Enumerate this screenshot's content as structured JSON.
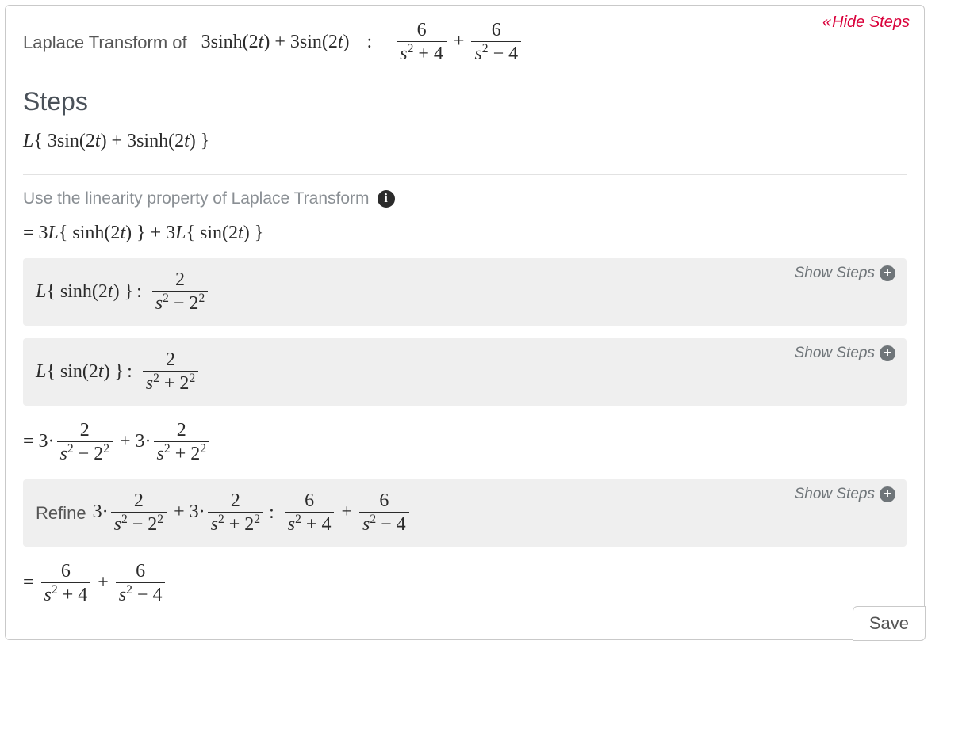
{
  "header": {
    "hide_steps_label": "Hide Steps",
    "problem_label": "Laplace Transform of",
    "problem_expr_html": "3sinh(2<span class='it'>t</span>) + 3sin(2<span class='it'>t</span>)",
    "result_html": "<span class='frac'><span class='num'>6</span><span class='den'><span class='it'>s</span><span class='sup'>2</span> + 4</span></span> + <span class='frac'><span class='num'>6</span><span class='den'><span class='it'>s</span><span class='sup'>2</span> − 4</span></span>"
  },
  "steps_title": "Steps",
  "initial_expr_html": "<span class='it'>L</span>{ 3sin(2<span class='it'>t</span>) + 3sinh(2<span class='it'>t</span>) }",
  "linearity_note": "Use the linearity property of Laplace Transform",
  "linearity_result_html": "= 3<span class='it'>L</span>{ sinh(2<span class='it'>t</span>) } + 3<span class='it'>L</span>{ sin(2<span class='it'>t</span>) }",
  "sub_steps": [
    {
      "lhs_html": "<span class='it'>L</span>{ sinh(2<span class='it'>t</span>) }",
      "rhs_html": "<span class='frac'><span class='num'>2</span><span class='den'><span class='it'>s</span><span class='sup'>2</span> − 2<span class='sup'>2</span></span></span>",
      "show_label": "Show Steps"
    },
    {
      "lhs_html": "<span class='it'>L</span>{ sin(2<span class='it'>t</span>) }",
      "rhs_html": "<span class='frac'><span class='num'>2</span><span class='den'><span class='it'>s</span><span class='sup'>2</span> + 2<span class='sup'>2</span></span></span>",
      "show_label": "Show Steps"
    }
  ],
  "combined_html": "= 3·<span class='frac'><span class='num'>2</span><span class='den'><span class='it'>s</span><span class='sup'>2</span> − 2<span class='sup'>2</span></span></span> + 3·<span class='frac'><span class='num'>2</span><span class='den'><span class='it'>s</span><span class='sup'>2</span> + 2<span class='sup'>2</span></span></span>",
  "refine": {
    "prefix": "Refine",
    "lhs_html": "3·<span class='frac'><span class='num'>2</span><span class='den'><span class='it'>s</span><span class='sup'>2</span> − 2<span class='sup'>2</span></span></span> + 3·<span class='frac'><span class='num'>2</span><span class='den'><span class='it'>s</span><span class='sup'>2</span> + 2<span class='sup'>2</span></span></span>",
    "rhs_html": "<span class='frac'><span class='num'>6</span><span class='den'><span class='it'>s</span><span class='sup'>2</span> + 4</span></span> + <span class='frac'><span class='num'>6</span><span class='den'><span class='it'>s</span><span class='sup'>2</span> − 4</span></span>",
    "show_label": "Show Steps"
  },
  "final_html": "= <span class='frac'><span class='num'>6</span><span class='den'><span class='it'>s</span><span class='sup'>2</span> + 4</span></span> + <span class='frac'><span class='num'>6</span><span class='den'><span class='it'>s</span><span class='sup'>2</span> − 4</span></span>",
  "save_label": "Save",
  "info_glyph": "i",
  "plus_glyph": "+",
  "chevrons": "«"
}
